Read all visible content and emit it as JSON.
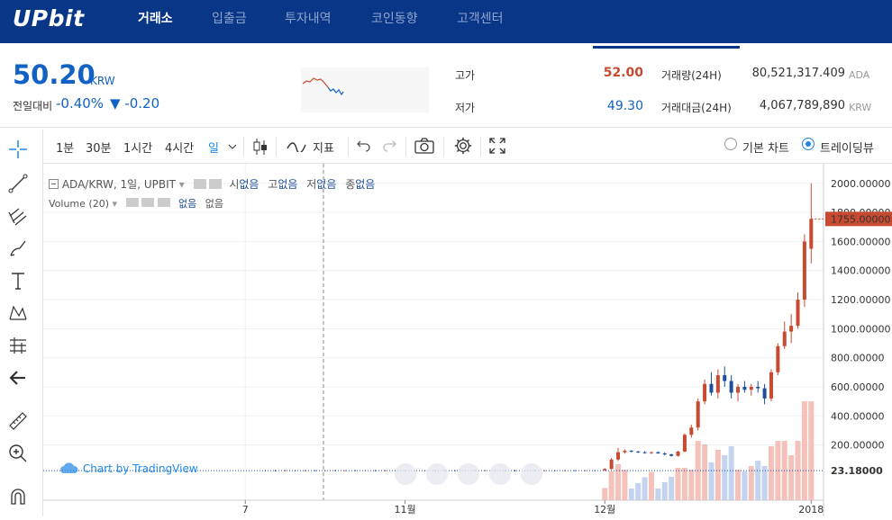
{
  "nav": {
    "logo": "UPbit",
    "items": [
      "거래소",
      "입출금",
      "투자내역",
      "코인동향",
      "고객센터"
    ]
  },
  "ticker": {
    "price": "50.20",
    "currency": "KRW",
    "change_label": "전일대비",
    "change_pct": "-0.40%",
    "change_val": "▼ -0.20",
    "high_label": "고가",
    "high": "52.00",
    "low_label": "저가",
    "low": "49.30",
    "vol_label": "거래량(24H)",
    "vol": "80,521,317.409",
    "vol_unit": "ADA",
    "amt_label": "거래대금(24H)",
    "amt": "4,067,789,890",
    "amt_unit": "KRW"
  },
  "toolbar": {
    "intervals": [
      "1분",
      "30분",
      "1시간",
      "4시간",
      "일"
    ],
    "indicator": "지표",
    "basic_chart": "기본 차트",
    "tradingview": "트레이딩뷰"
  },
  "legend": {
    "symbol": "ADA/KRW, 1일, UPBIT",
    "o_label": "시",
    "o_val": "없음",
    "h_label": "고",
    "h_val": "없음",
    "l_label": "저",
    "l_val": "없음",
    "c_label": "종",
    "c_val": "없음",
    "volume": "Volume (20)",
    "vol_val1": "없음",
    "vol_val2": "없음",
    "watermark": "Chart by TradingView"
  },
  "chart_data": {
    "type": "candlestick",
    "y_ticks": [
      200,
      400,
      600,
      800,
      1000,
      1200,
      1400,
      1600,
      1800,
      2000
    ],
    "y_tick_labels": [
      "200.00000",
      "400.00000",
      "600.00000",
      "800.00000",
      "1000.00000",
      "1200.00000",
      "1400.00000",
      "1600.00000",
      "1800.00000",
      "2000.00000"
    ],
    "ylim": [
      -180,
      2100
    ],
    "x_labels": [
      "7",
      "11월",
      "12월",
      "2018"
    ],
    "x_label_days": [
      37,
      61,
      91,
      122
    ],
    "last_price_label": "1755.00000",
    "last_price": 1755,
    "line_price_label": "23.18000",
    "line_price": 23.18,
    "ohlc": [
      [
        91,
        25,
        40,
        22,
        35
      ],
      [
        92,
        35,
        110,
        30,
        100
      ],
      [
        93,
        100,
        180,
        90,
        150
      ],
      [
        94,
        150,
        170,
        140,
        160
      ],
      [
        95,
        160,
        165,
        150,
        155
      ],
      [
        96,
        155,
        160,
        145,
        150
      ],
      [
        97,
        150,
        158,
        140,
        145
      ],
      [
        98,
        145,
        155,
        138,
        150
      ],
      [
        99,
        150,
        155,
        140,
        142
      ],
      [
        100,
        142,
        150,
        130,
        135
      ],
      [
        101,
        135,
        140,
        120,
        125
      ],
      [
        102,
        125,
        160,
        120,
        155
      ],
      [
        103,
        155,
        280,
        150,
        270
      ],
      [
        104,
        270,
        340,
        250,
        320
      ],
      [
        105,
        320,
        520,
        300,
        500
      ],
      [
        106,
        500,
        650,
        480,
        620
      ],
      [
        107,
        620,
        700,
        540,
        560
      ],
      [
        108,
        560,
        720,
        520,
        680
      ],
      [
        109,
        680,
        740,
        600,
        640
      ],
      [
        110,
        640,
        680,
        520,
        560
      ],
      [
        111,
        560,
        620,
        500,
        600
      ],
      [
        112,
        600,
        640,
        560,
        580
      ],
      [
        113,
        580,
        620,
        540,
        600
      ],
      [
        114,
        600,
        640,
        560,
        590
      ],
      [
        115,
        590,
        620,
        480,
        520
      ],
      [
        116,
        520,
        720,
        500,
        700
      ],
      [
        117,
        700,
        900,
        680,
        880
      ],
      [
        118,
        880,
        1050,
        860,
        980
      ],
      [
        119,
        980,
        1100,
        900,
        1020
      ],
      [
        120,
        1020,
        1250,
        1000,
        1200
      ],
      [
        121,
        1200,
        1650,
        1150,
        1600
      ],
      [
        122,
        1550,
        2000,
        1450,
        1755
      ]
    ]
  }
}
